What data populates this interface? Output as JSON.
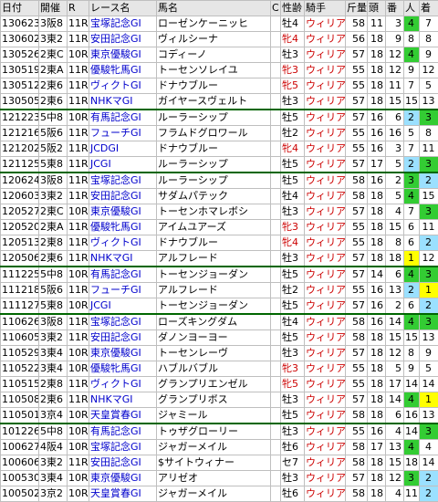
{
  "headers": [
    "日付",
    "開催",
    "R",
    "レース名",
    "馬名",
    "C",
    "性齢",
    "騎手",
    "斤量",
    "頭",
    "番",
    "人",
    "着"
  ],
  "rows": [
    [
      "130623",
      "3阪8",
      "11R",
      "宝塚記念GI",
      "ローゼンケーニッヒ",
      "",
      "牡4",
      "ウィリア",
      "58",
      "11",
      "3",
      "4",
      "7"
    ],
    [
      "130602",
      "3東2",
      "11R",
      "安田記念GI",
      "ヴィルシーナ",
      "",
      "牝4",
      "ウィリア",
      "56",
      "18",
      "9",
      "8",
      "8"
    ],
    [
      "130526",
      "2東C",
      "10R",
      "東京優駿GI",
      "コディーノ",
      "",
      "牡3",
      "ウィリア",
      "57",
      "18",
      "12",
      "4",
      "9"
    ],
    [
      "130519",
      "2東A",
      "11R",
      "優駿牝馬GI",
      "トーセンソレイユ",
      "",
      "牝3",
      "ウィリア",
      "55",
      "18",
      "12",
      "9",
      "12"
    ],
    [
      "130512",
      "2東6",
      "11R",
      "ヴィクトGI",
      "ドナウブルー",
      "",
      "牝5",
      "ウィリア",
      "55",
      "18",
      "11",
      "7",
      "5"
    ],
    [
      "130505",
      "2東6",
      "11R",
      "NHKマGI",
      "ガイヤースヴェルト",
      "",
      "牡3",
      "ウィリア",
      "57",
      "18",
      "15",
      "15",
      "13"
    ],
    [
      "121223",
      "5中8",
      "10R",
      "有馬記念GI",
      "ルーラーシップ",
      "",
      "牡5",
      "ウィリア",
      "57",
      "16",
      "6",
      "2",
      "3"
    ],
    [
      "121216",
      "5阪6",
      "11R",
      "フューチGI",
      "フラムドグロワール",
      "",
      "牡2",
      "ウィリア",
      "55",
      "16",
      "16",
      "5",
      "8"
    ],
    [
      "121202",
      "5阪2",
      "11R",
      "JCDGI",
      "ドナウブルー",
      "",
      "牝4",
      "ウィリア",
      "55",
      "16",
      "3",
      "7",
      "11"
    ],
    [
      "121125",
      "5東8",
      "11R",
      "JCGI",
      "ルーラーシップ",
      "",
      "牡5",
      "ウィリア",
      "57",
      "17",
      "5",
      "2",
      "3"
    ],
    [
      "120624",
      "3阪8",
      "11R",
      "宝塚記念GI",
      "ルーラーシップ",
      "",
      "牡5",
      "ウィリア",
      "58",
      "16",
      "2",
      "3",
      "2"
    ],
    [
      "120603",
      "3東2",
      "11R",
      "安田記念GI",
      "サダムパテック",
      "",
      "牡4",
      "ウィリア",
      "58",
      "18",
      "5",
      "4",
      "15"
    ],
    [
      "120527",
      "2東C",
      "10R",
      "東京優駿GI",
      "トーセンホマレボシ",
      "",
      "牡3",
      "ウィリア",
      "57",
      "18",
      "4",
      "7",
      "3"
    ],
    [
      "120520",
      "2東A",
      "11R",
      "優駿牝馬GI",
      "アイムユアーズ",
      "",
      "牝3",
      "ウィリア",
      "55",
      "18",
      "15",
      "6",
      "11"
    ],
    [
      "120513",
      "2東8",
      "11R",
      "ヴィクトGI",
      "ドナウブルー",
      "",
      "牝4",
      "ウィリア",
      "55",
      "18",
      "8",
      "6",
      "2"
    ],
    [
      "120506",
      "2東6",
      "11R",
      "NHKマGI",
      "アルフレード",
      "",
      "牡3",
      "ウィリア",
      "57",
      "18",
      "18",
      "1",
      "12"
    ],
    [
      "111225",
      "5中8",
      "10R",
      "有馬記念GI",
      "トーセンジョーダン",
      "",
      "牡5",
      "ウィリア",
      "57",
      "14",
      "6",
      "4",
      "3"
    ],
    [
      "111218",
      "5阪6",
      "11R",
      "フューチGI",
      "アルフレード",
      "",
      "牡2",
      "ウィリア",
      "55",
      "16",
      "13",
      "2",
      "1"
    ],
    [
      "111127",
      "5東8",
      "10R",
      "JCGI",
      "トーセンジョーダン",
      "",
      "牡5",
      "ウィリア",
      "57",
      "16",
      "2",
      "6",
      "2"
    ],
    [
      "110626",
      "3阪8",
      "11R",
      "宝塚記念GI",
      "ローズキングダム",
      "",
      "牡4",
      "ウィリア",
      "58",
      "16",
      "14",
      "4",
      "3"
    ],
    [
      "110605",
      "3東2",
      "11R",
      "安田記念GI",
      "ダノンヨーヨー",
      "",
      "牡5",
      "ウィリア",
      "58",
      "18",
      "15",
      "15",
      "13"
    ],
    [
      "110529",
      "3東4",
      "10R",
      "東京優駿GI",
      "トーセンレーヴ",
      "",
      "牡3",
      "ウィリア",
      "57",
      "18",
      "12",
      "8",
      "9"
    ],
    [
      "110522",
      "3東4",
      "10R",
      "優駿牝馬GI",
      "ハブルバブル",
      "",
      "牝3",
      "ウィリア",
      "55",
      "18",
      "5",
      "9",
      "5"
    ],
    [
      "110515",
      "2東8",
      "11R",
      "ヴィクトGI",
      "グランプリエンゼル",
      "",
      "牝5",
      "ウィリア",
      "55",
      "18",
      "17",
      "14",
      "14"
    ],
    [
      "110508",
      "2東6",
      "11R",
      "NHKマGI",
      "グランプリボス",
      "",
      "牡3",
      "ウィリア",
      "57",
      "18",
      "14",
      "4",
      "1"
    ],
    [
      "110501",
      "3京4",
      "10R",
      "天皇賞春GI",
      "ジャミール",
      "",
      "牡5",
      "ウィリア",
      "58",
      "18",
      "6",
      "16",
      "13"
    ],
    [
      "101226",
      "5中8",
      "10R",
      "有馬記念GI",
      "トゥザグローリー",
      "",
      "牡3",
      "ウィリア",
      "55",
      "16",
      "4",
      "14",
      "3"
    ],
    [
      "100627",
      "4阪4",
      "10R",
      "宝塚記念GI",
      "ジャガーメイル",
      "",
      "牡6",
      "ウィリア",
      "58",
      "17",
      "13",
      "4",
      "4"
    ],
    [
      "100606",
      "3東2",
      "11R",
      "安田記念GI",
      "$サイトウィナー",
      "",
      "セ7",
      "ウィリア",
      "58",
      "18",
      "15",
      "18",
      "14"
    ],
    [
      "100530",
      "3東4",
      "10R",
      "東京優駿GI",
      "アリゼオ",
      "",
      "牡3",
      "ウィリア",
      "57",
      "18",
      "12",
      "3",
      "2"
    ],
    [
      "100502",
      "3京2",
      "10R",
      "天皇賞春GI",
      "ジャガーメイル",
      "",
      "牡6",
      "ウィリア",
      "58",
      "18",
      "4",
      "11",
      "2"
    ]
  ]
}
